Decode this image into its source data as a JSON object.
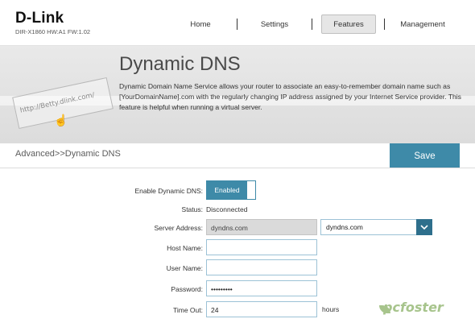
{
  "header": {
    "brand": "D-Link",
    "model": "DIR-X1860 HW:A1 FW:1.02",
    "nav": {
      "home": "Home",
      "settings": "Settings",
      "features": "Features",
      "management": "Management"
    },
    "active_tab": "Features"
  },
  "banner": {
    "title": "Dynamic DNS",
    "description": "Dynamic Domain Name Service allows your router to associate an easy-to-remember domain name such as [YourDomainName].com with the regularly changing IP address assigned by your Internet Service provider. This feature is helpful when running a virtual server.",
    "illustration_text": "http://Betty.dlink.com/"
  },
  "subheader": {
    "breadcrumb": "Advanced>>Dynamic DNS",
    "save_label": "Save"
  },
  "form": {
    "enable": {
      "label": "Enable Dynamic DNS:",
      "value": "Enabled"
    },
    "status": {
      "label": "Status:",
      "value": "Disconnected"
    },
    "server_address": {
      "label": "Server Address:",
      "value": "dyndns.com",
      "select_value": "dyndns.com"
    },
    "host_name": {
      "label": "Host Name:",
      "value": ""
    },
    "user_name": {
      "label": "User Name:",
      "value": ""
    },
    "password": {
      "label": "Password:",
      "value": "•••••••••"
    },
    "timeout": {
      "label": "Time Out:",
      "value": "24",
      "unit": "hours"
    }
  },
  "watermark": "pcfoster",
  "colors": {
    "accent": "#3e8aa8",
    "dropdown_button": "#2e6f8c",
    "field_border": "#9cc2d6"
  }
}
